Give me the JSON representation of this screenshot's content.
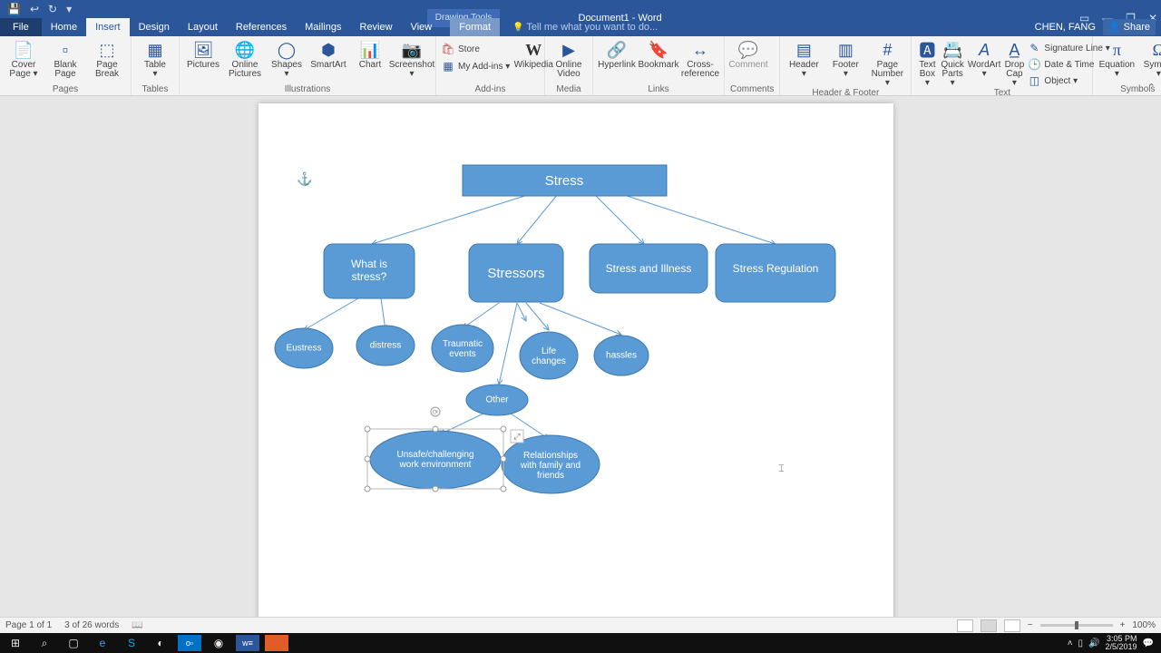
{
  "window": {
    "title": "Document1 - Word",
    "context_tab": "Drawing Tools",
    "user": "CHEN, FANG",
    "share": "Share"
  },
  "tabs": {
    "file": "File",
    "list": [
      "Home",
      "Insert",
      "Design",
      "Layout",
      "References",
      "Mailings",
      "Review",
      "View"
    ],
    "context": "Format",
    "active": "Insert",
    "tellme": "Tell me what you want to do..."
  },
  "ribbon": {
    "pages": {
      "label": "Pages",
      "cover": "Cover\nPage ▾",
      "blank": "Blank\nPage",
      "break": "Page\nBreak"
    },
    "tables": {
      "label": "Tables",
      "table": "Table\n▾"
    },
    "illus": {
      "label": "Illustrations",
      "pictures": "Pictures",
      "online": "Online\nPictures",
      "shapes": "Shapes\n▾",
      "smartart": "SmartArt",
      "chart": "Chart",
      "screenshot": "Screenshot\n▾"
    },
    "addins": {
      "label": "Add-ins",
      "store": "Store",
      "myaddins": "My Add-ins ▾",
      "wikipedia": "Wikipedia"
    },
    "media": {
      "label": "Media",
      "video": "Online\nVideo"
    },
    "links": {
      "label": "Links",
      "hyperlink": "Hyperlink",
      "bookmark": "Bookmark",
      "crossref": "Cross-\nreference"
    },
    "comments": {
      "label": "Comments",
      "comment": "Comment"
    },
    "hf": {
      "label": "Header & Footer",
      "header": "Header\n▾",
      "footer": "Footer\n▾",
      "pagenum": "Page\nNumber ▾"
    },
    "text": {
      "label": "Text",
      "textbox": "Text\nBox ▾",
      "quick": "Quick\nParts ▾",
      "wordart": "WordArt\n▾",
      "dropcap": "Drop\nCap ▾",
      "sig": "Signature Line ▾",
      "date": "Date & Time",
      "obj": "Object ▾"
    },
    "symbols": {
      "label": "Symbols",
      "equation": "Equation\n▾",
      "symbol": "Symbol\n▾"
    }
  },
  "diagram": {
    "root": "Stress",
    "lvl2": [
      "What is stress?",
      "Stressors",
      "Stress and Illness",
      "Stress Regulation"
    ],
    "lvl3_whatis": [
      "Eustress",
      "distress"
    ],
    "lvl3_stressors": [
      "Traumatic events",
      "Life changes",
      "hassles"
    ],
    "other": "Other",
    "lvl4": [
      "Unsafe/challenging work environment",
      "Relationships with family and friends"
    ]
  },
  "status": {
    "page": "Page 1 of 1",
    "words": "3 of 26 words",
    "zoom": "100%"
  },
  "taskbar": {
    "time": "3:05 PM",
    "date": "2/5/2019"
  }
}
